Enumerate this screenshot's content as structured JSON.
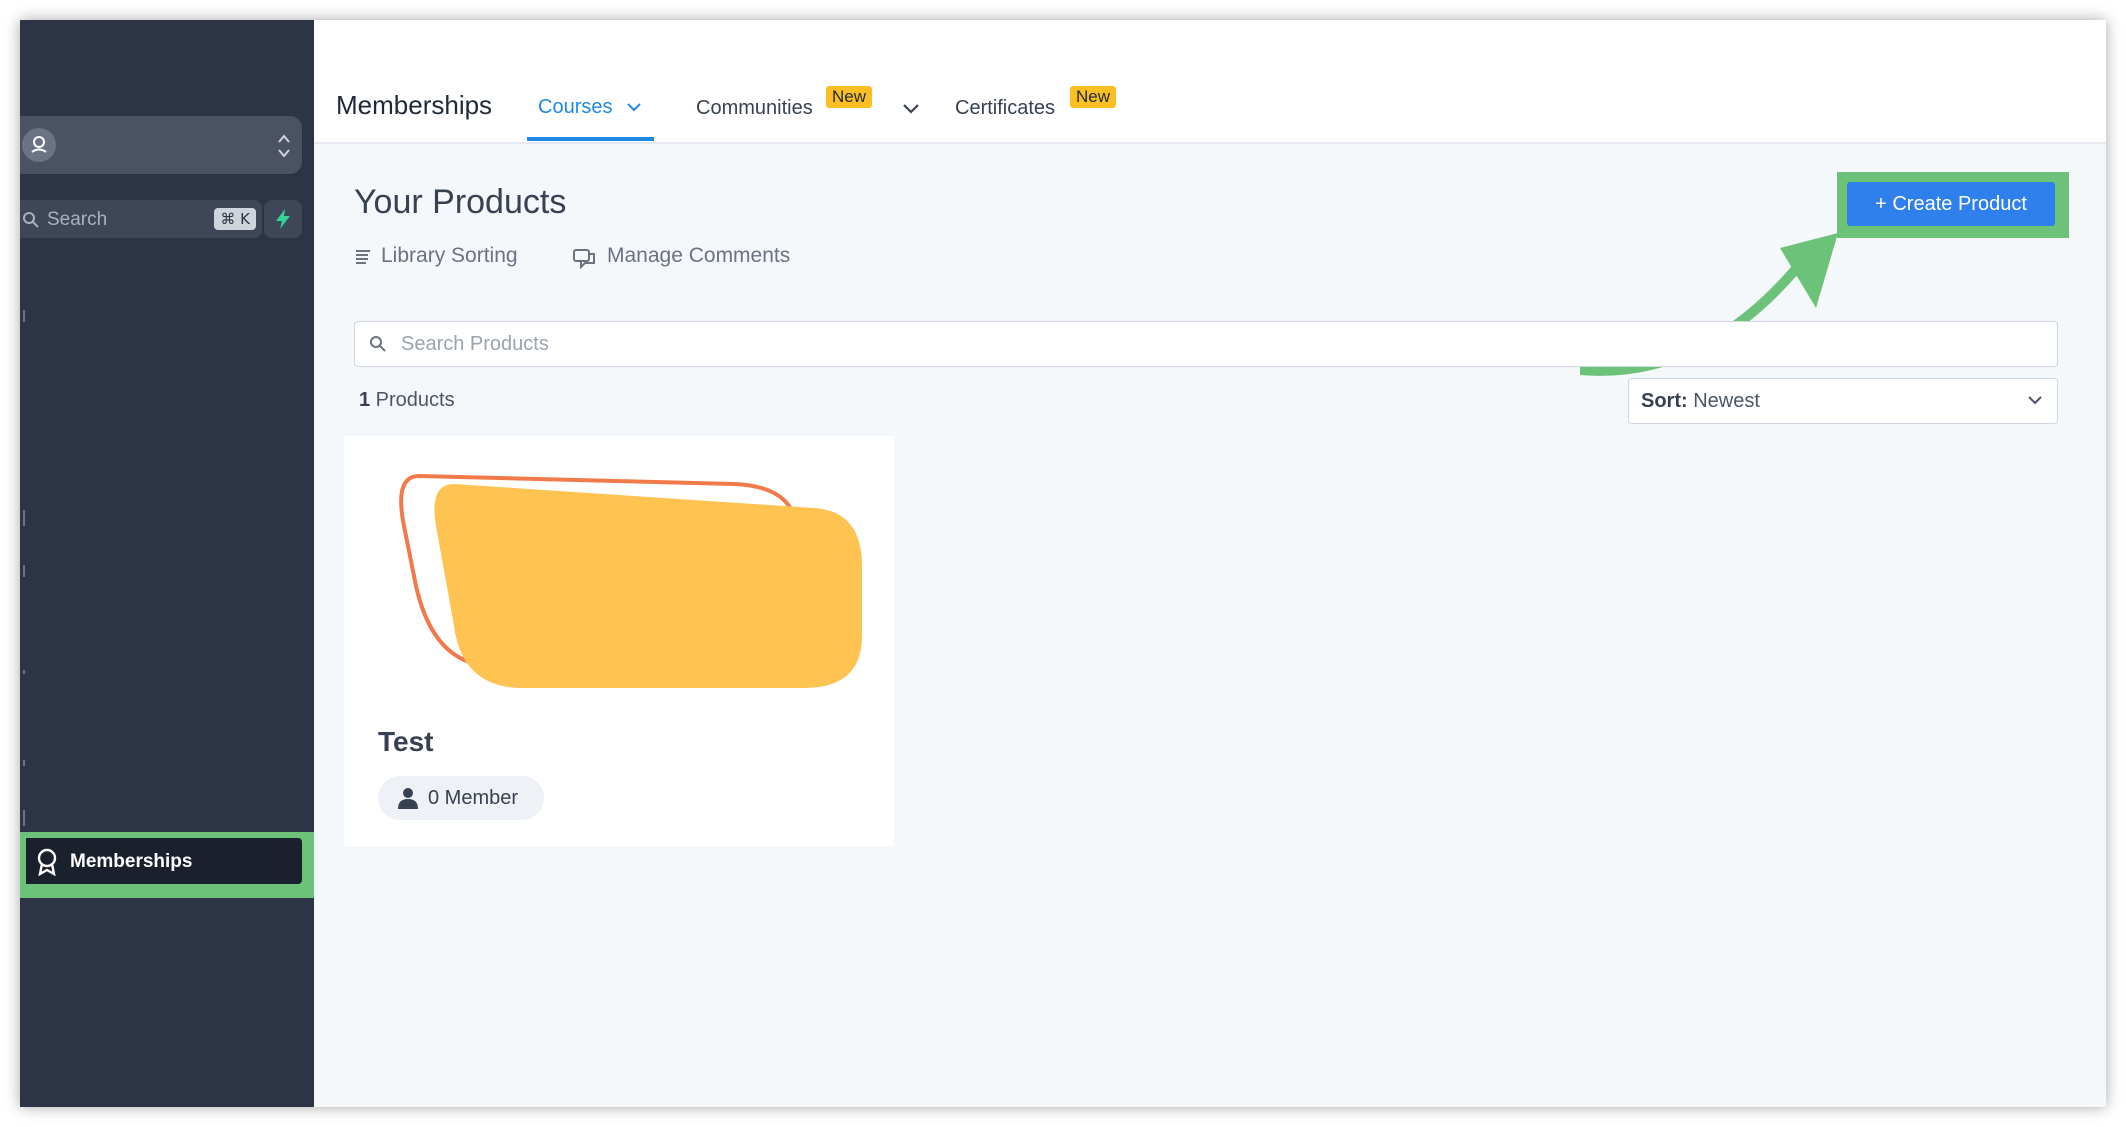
{
  "sidebar": {
    "search_placeholder": "Search",
    "search_shortcut": "⌘ K",
    "active_item": {
      "label": "Memberships",
      "icon": "award-ribbon-icon"
    }
  },
  "header": {
    "title": "Memberships",
    "tabs": [
      {
        "label": "Courses",
        "active": true,
        "has_dropdown": true
      },
      {
        "label": "Communities",
        "badge": "New"
      },
      {
        "label": "Certificates",
        "badge": "New"
      }
    ]
  },
  "main": {
    "title": "Your Products",
    "actions": [
      {
        "label": "Library Sorting",
        "icon": "list-lines-icon"
      },
      {
        "label": "Manage Comments",
        "icon": "chat-bubbles-icon"
      }
    ],
    "create_button": "+ Create Product",
    "search_placeholder": "Search Products",
    "count_number": "1",
    "count_label": " Products",
    "sort_label": "Sort:",
    "sort_value": " Newest",
    "products": [
      {
        "title": "Test",
        "members": "0 Member"
      }
    ]
  },
  "colors": {
    "sidebar_bg": "#2c3445",
    "accent_blue": "#2f80ed",
    "highlight_green": "#6cc278",
    "badge_yellow": "#fbbf24",
    "thumb_orange": "#f07a4a",
    "thumb_yellow": "#fec350"
  }
}
